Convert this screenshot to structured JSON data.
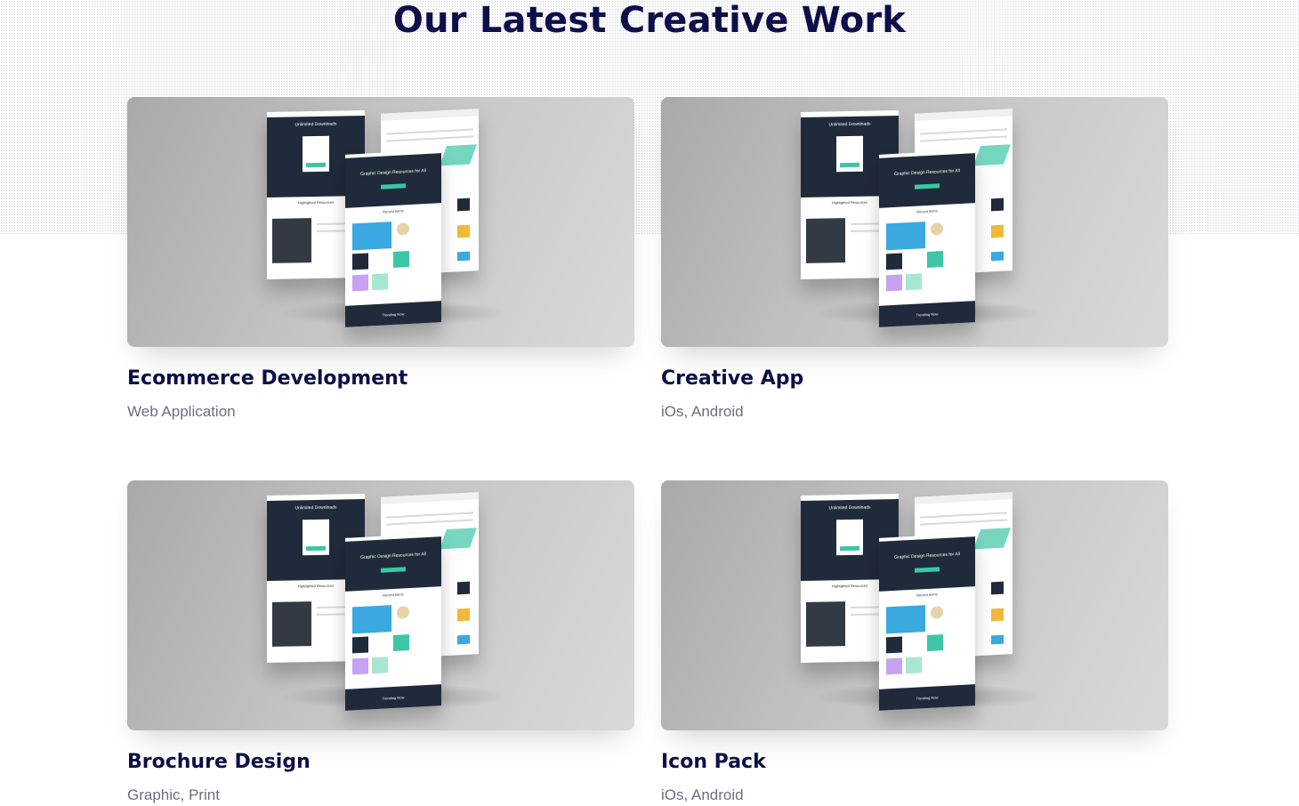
{
  "section": {
    "title": "Our Latest Creative Work"
  },
  "projects": [
    {
      "title": "Ecommerce Development",
      "category": "Web Application"
    },
    {
      "title": "Creative App",
      "category": "iOs, Android"
    },
    {
      "title": "Brochure Design",
      "category": "Graphic, Print"
    },
    {
      "title": "Icon Pack",
      "category": "iOs, Android"
    }
  ],
  "mockup_text": {
    "left_page_heading": "Unlimited Downloads",
    "front_page_heading": "Graphic Design Resources for All",
    "left_page_sub": "Highlighted Resources",
    "front_page_sub": "Recent Items",
    "front_page_footer": "Trending Now"
  },
  "colors": {
    "title": "#0e0e4a",
    "subtitle": "#6b6f80",
    "mock_dark": "#1f2a3a",
    "mock_accent": "#3cc6a5"
  }
}
